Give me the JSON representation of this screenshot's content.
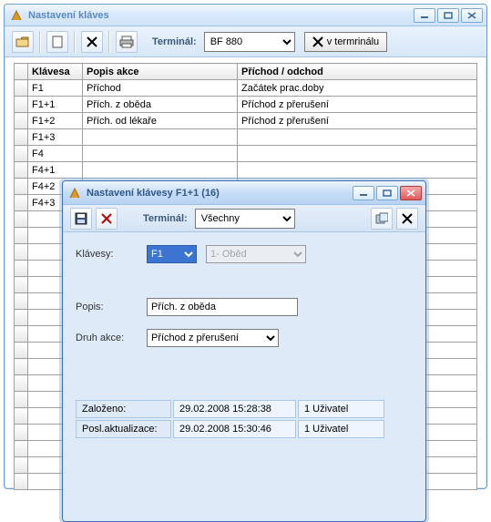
{
  "outer": {
    "title": "Nastavení kláves",
    "toolbar": {
      "terminal_label": "Terminál:",
      "terminal_value": "BF 880",
      "in_terminal_btn": "v termrinálu"
    },
    "columns": [
      "Klávesa",
      "Popis akce",
      "Příchod / odchod"
    ],
    "rows": [
      {
        "k": "F1",
        "p": "Příchod",
        "a": "Začátek prac.doby"
      },
      {
        "k": "F1+1",
        "p": "Přích. z oběda",
        "a": "Příchod z přerušení"
      },
      {
        "k": "F1+2",
        "p": "Přích. od lékaře",
        "a": "Příchod z přerušení"
      },
      {
        "k": "F1+3",
        "p": "",
        "a": ""
      },
      {
        "k": "F4",
        "p": "",
        "a": ""
      },
      {
        "k": "F4+1",
        "p": "",
        "a": ""
      },
      {
        "k": "F4+2",
        "p": "",
        "a": ""
      },
      {
        "k": "F4+3",
        "p": "",
        "a": ""
      }
    ],
    "blank_rows": 17
  },
  "dialog": {
    "title": "Nastavení klávesy F1+1 (16)",
    "toolbar": {
      "terminal_label": "Terminál:",
      "terminal_value": "Všechny"
    },
    "klavesy_label": "Klávesy:",
    "klavesy_main": "F1",
    "klavesy_sub": "1- Oběd",
    "popis_label": "Popis:",
    "popis_value": "Přích. z oběda",
    "druh_label": "Druh akce:",
    "druh_value": "Příchod z přerušení",
    "zalozeno_label": "Založeno:",
    "zalozeno_ts": "29.02.2008 15:28:38",
    "zalozeno_user": "1 Uživatel",
    "posl_label": "Posl.aktualizace:",
    "posl_ts": "29.02.2008 15:30:46",
    "posl_user": "1 Uživatel"
  }
}
